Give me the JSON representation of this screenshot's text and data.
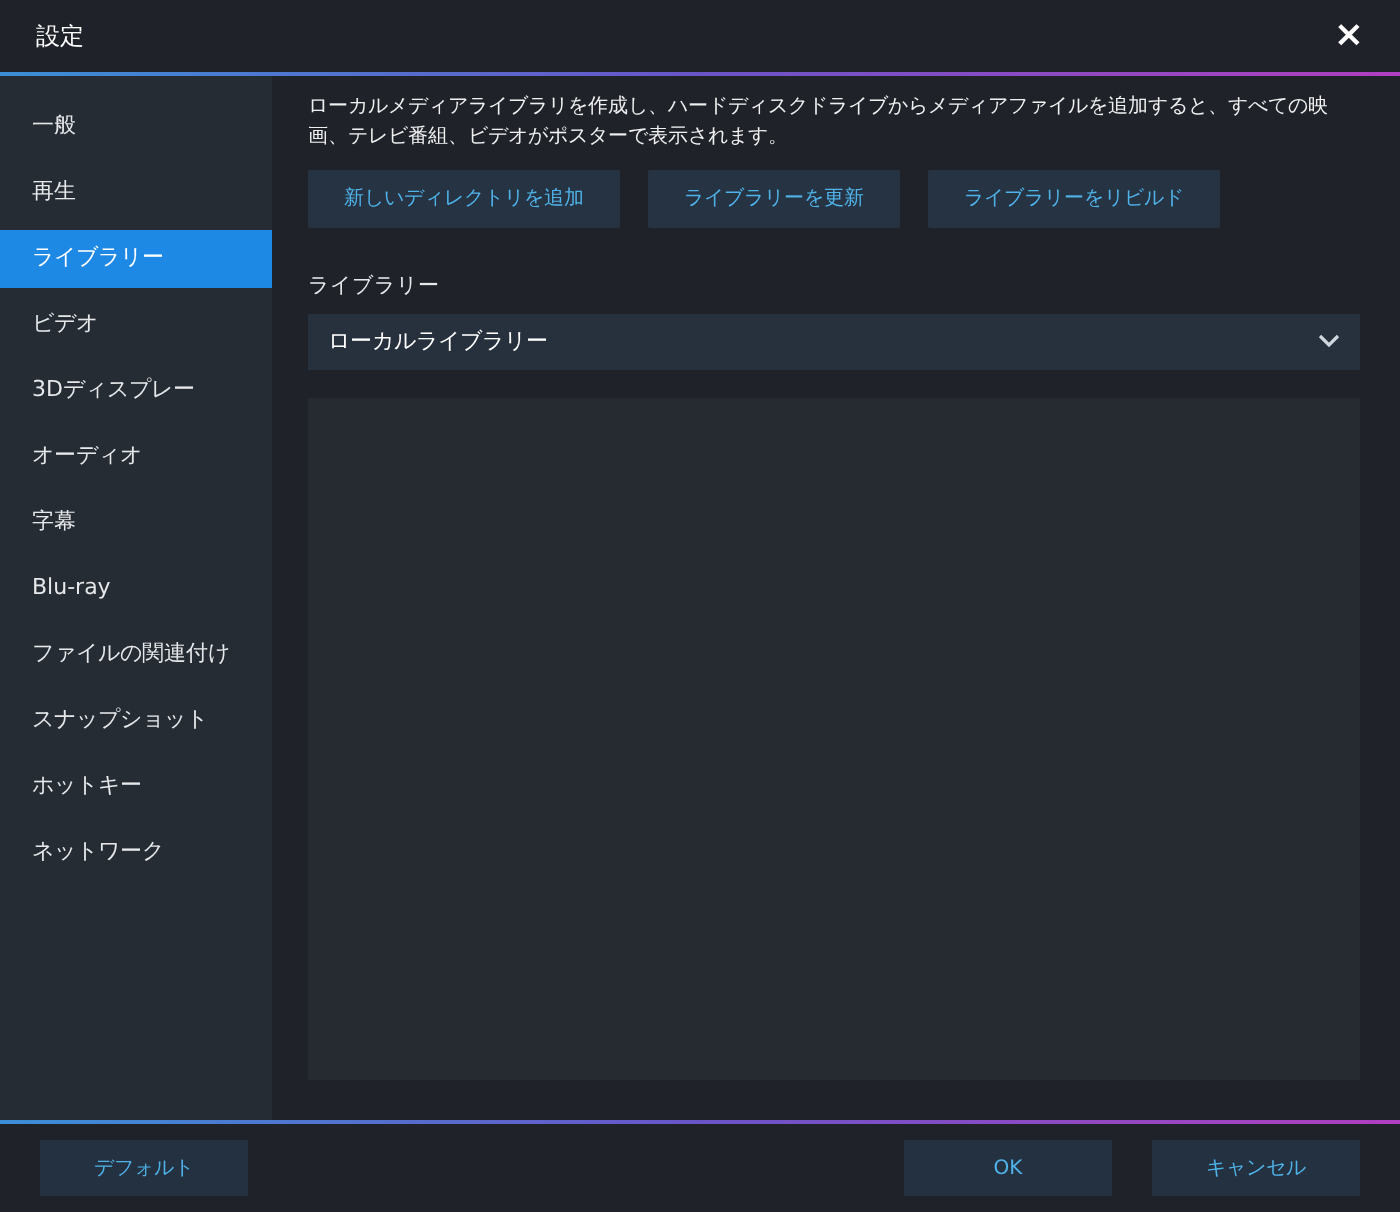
{
  "window": {
    "title": "設定",
    "close": "×"
  },
  "sidebar": {
    "items": [
      {
        "label": "一般",
        "selected": false
      },
      {
        "label": "再生",
        "selected": false
      },
      {
        "label": "ライブラリー",
        "selected": true
      },
      {
        "label": "ビデオ",
        "selected": false
      },
      {
        "label": "3Dディスプレー",
        "selected": false
      },
      {
        "label": "オーディオ",
        "selected": false
      },
      {
        "label": "字幕",
        "selected": false
      },
      {
        "label": "Blu-ray",
        "selected": false
      },
      {
        "label": "ファイルの関連付け",
        "selected": false
      },
      {
        "label": "スナップショット",
        "selected": false
      },
      {
        "label": "ホットキー",
        "selected": false
      },
      {
        "label": "ネットワーク",
        "selected": false
      }
    ]
  },
  "description": "ローカルメディアライブラリを作成し、ハードディスクドライブからメディアファイルを追加すると、すべての映画、テレビ番組、ビデオがポスターで表示されます。",
  "actions": [
    "新しいディレクトリを追加",
    "ライブラリーを更新",
    "ライブラリーをリビルド"
  ],
  "library": {
    "label": "ライブラリー",
    "value": "ローカルライブラリー"
  },
  "footer": {
    "left_buttons": [
      "デフォルト"
    ],
    "right_buttons": [
      "OK",
      "キャンセル"
    ]
  }
}
